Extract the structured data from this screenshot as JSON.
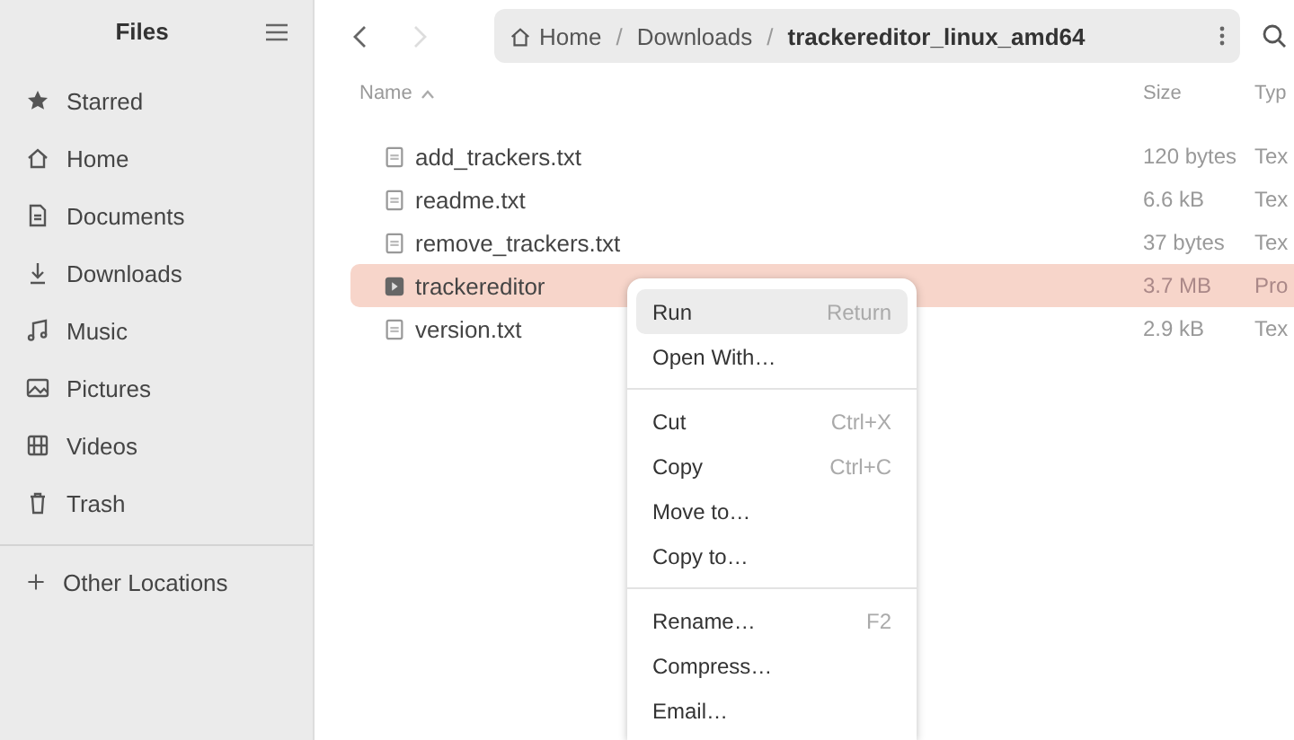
{
  "sidebar": {
    "title": "Files",
    "items": [
      {
        "label": "Starred"
      },
      {
        "label": "Home"
      },
      {
        "label": "Documents"
      },
      {
        "label": "Downloads"
      },
      {
        "label": "Music"
      },
      {
        "label": "Pictures"
      },
      {
        "label": "Videos"
      },
      {
        "label": "Trash"
      }
    ],
    "other_locations": {
      "label": "Other Locations"
    }
  },
  "header": {
    "back": {
      "disabled": false
    },
    "forward": {
      "disabled": true
    },
    "path": [
      {
        "label": "Home",
        "current": false
      },
      {
        "label": "Downloads",
        "current": false
      },
      {
        "label": "trackereditor_linux_amd64",
        "current": true
      }
    ],
    "separator": "/"
  },
  "table": {
    "columns": [
      "Name",
      "Size",
      "Typ"
    ],
    "rows": [
      {
        "name": "add_trackers.txt",
        "size": "120 bytes",
        "type": "Tex",
        "kind": "text",
        "selected": false
      },
      {
        "name": "readme.txt",
        "size": "6.6 kB",
        "type": "Tex",
        "kind": "text",
        "selected": false
      },
      {
        "name": "remove_trackers.txt",
        "size": "37 bytes",
        "type": "Tex",
        "kind": "text",
        "selected": false
      },
      {
        "name": "trackereditor",
        "size": "3.7 MB",
        "type": "Pro",
        "kind": "program",
        "selected": true
      },
      {
        "name": "version.txt",
        "size": "2.9 kB",
        "type": "Tex",
        "kind": "text",
        "selected": false
      }
    ]
  },
  "context_menu": {
    "sections": [
      [
        {
          "label": "Run",
          "shortcut": "Return",
          "selected": true
        },
        {
          "label": "Open With…",
          "selected": false
        }
      ],
      [
        {
          "label": "Cut",
          "shortcut": "Ctrl+X",
          "selected": false
        },
        {
          "label": "Copy",
          "shortcut": "Ctrl+C",
          "selected": false
        },
        {
          "label": "Move to…",
          "selected": false
        },
        {
          "label": "Copy to…",
          "selected": false
        }
      ],
      [
        {
          "label": "Rename…",
          "shortcut": "F2",
          "selected": false
        },
        {
          "label": "Compress…",
          "selected": false
        },
        {
          "label": "Email…",
          "selected": false
        }
      ]
    ]
  }
}
